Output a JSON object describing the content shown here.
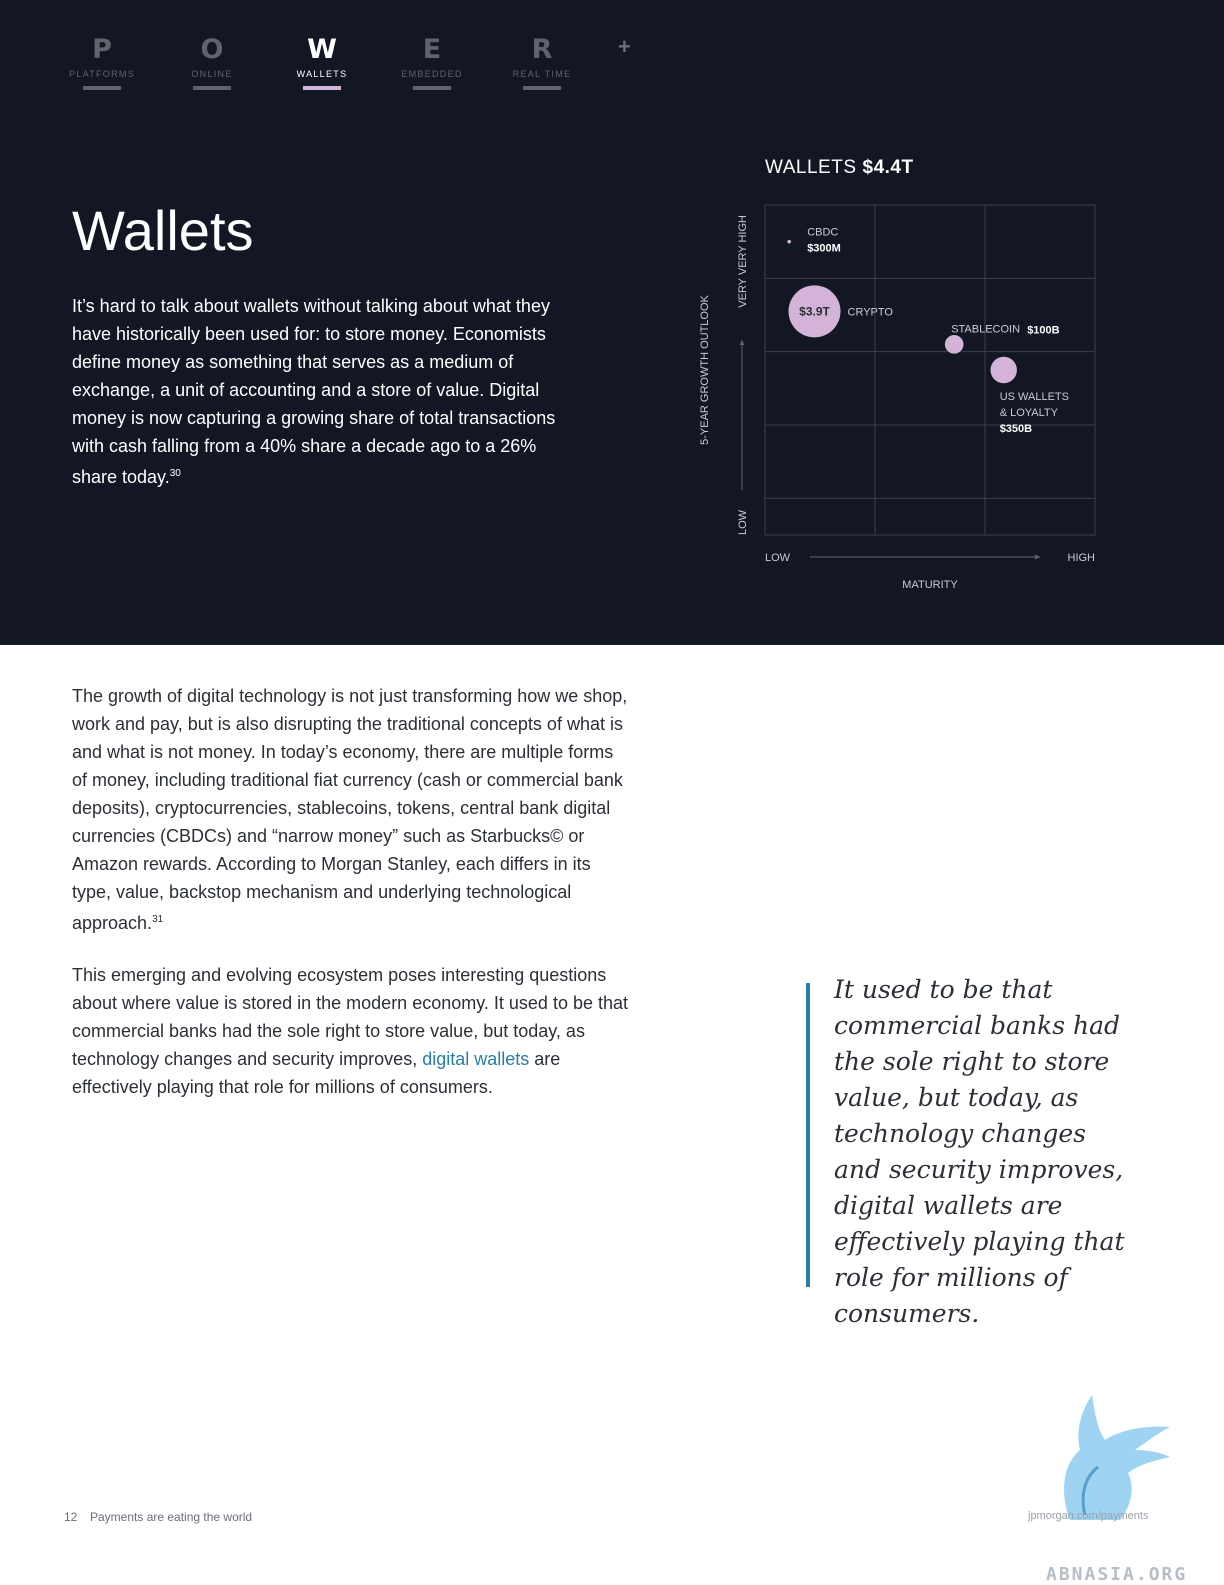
{
  "nav": {
    "items": [
      {
        "letter": "P",
        "label": "PLATFORMS"
      },
      {
        "letter": "O",
        "label": "ONLINE"
      },
      {
        "letter": "W",
        "label": "WALLETS"
      },
      {
        "letter": "E",
        "label": "EMBEDDED"
      },
      {
        "letter": "R",
        "label": "REAL TIME"
      }
    ],
    "active": "WALLETS",
    "plus": "+"
  },
  "hero": {
    "title": "Wallets",
    "intro": "It’s hard to talk about wallets without talking about what they have historically been used for: to store money. Economists define money as something that serves as a medium of exchange, a unit of accounting and a store of value. Digital money is now capturing a growing share of total transactions with cash falling from a 40% share a decade ago to a 26% share today.",
    "intro_ref": "30"
  },
  "chart_data": {
    "type": "scatter",
    "title": "WALLETS",
    "title_value": "$4.4T",
    "xlabel": "MATURITY",
    "ylabel": "5-YEAR GROWTH OUTLOOK",
    "x_ticks": [
      "LOW",
      "HIGH"
    ],
    "y_ticks": [
      "LOW",
      "VERY VERY HIGH"
    ],
    "grid": true,
    "x_scale": "0 = low maturity, 3 = high maturity",
    "y_scale": "0 = low growth, 4.5 = very very high growth",
    "bubble_color": "#d4b3d8",
    "points": [
      {
        "name": "CBDC",
        "value": "$300M",
        "value_num_billions": 0.3,
        "x": 0.22,
        "y": 4.0
      },
      {
        "name": "CRYPTO",
        "value": "$3.9T",
        "value_num_billions": 3900,
        "x": 0.45,
        "y": 3.05
      },
      {
        "name": "STABLECOIN",
        "value": "$100B",
        "value_num_billions": 100,
        "x": 1.72,
        "y": 2.6
      },
      {
        "name": "US WALLETS & LOYALTY",
        "value": "$350B",
        "value_num_billions": 350,
        "x": 2.17,
        "y": 2.25
      }
    ]
  },
  "body": {
    "para1": "The growth of digital technology is not just transforming how we shop, work and pay, but is also disrupting the traditional concepts of what is and what is not money. In today’s economy, there are multiple forms of money, including traditional fiat currency (cash or commercial bank deposits), cryptocurrencies, stablecoins, tokens, central bank digital currencies (CBDCs) and “narrow money” such as Starbucks© or Amazon rewards. According to Morgan Stanley, each differs in its type, value, backstop mechanism and underlying technological approach.",
    "para1_ref": "31",
    "para2_before": "This emerging and evolving ecosystem poses interesting questions about where value is stored in the modern economy. It used to be that commercial banks had the sole right to store value, but today, as technology changes and security improves,",
    "para2_link": "digital wallets",
    "para2_after": "are effectively playing that role for millions of consumers."
  },
  "quote": {
    "text": "It used to be that commercial banks had the sole right to store value, but today, as technology changes and security improves, digital wallets are effectively playing that role for millions of consumers.",
    "accent_color": "#2a7da4"
  },
  "footer": {
    "page_number": "12",
    "title": "Payments are eating the world",
    "url": "jpmorgan.com/payments"
  },
  "watermark": {
    "text": "ABNASIA.ORG",
    "logo": "blue-griffin-logo"
  }
}
